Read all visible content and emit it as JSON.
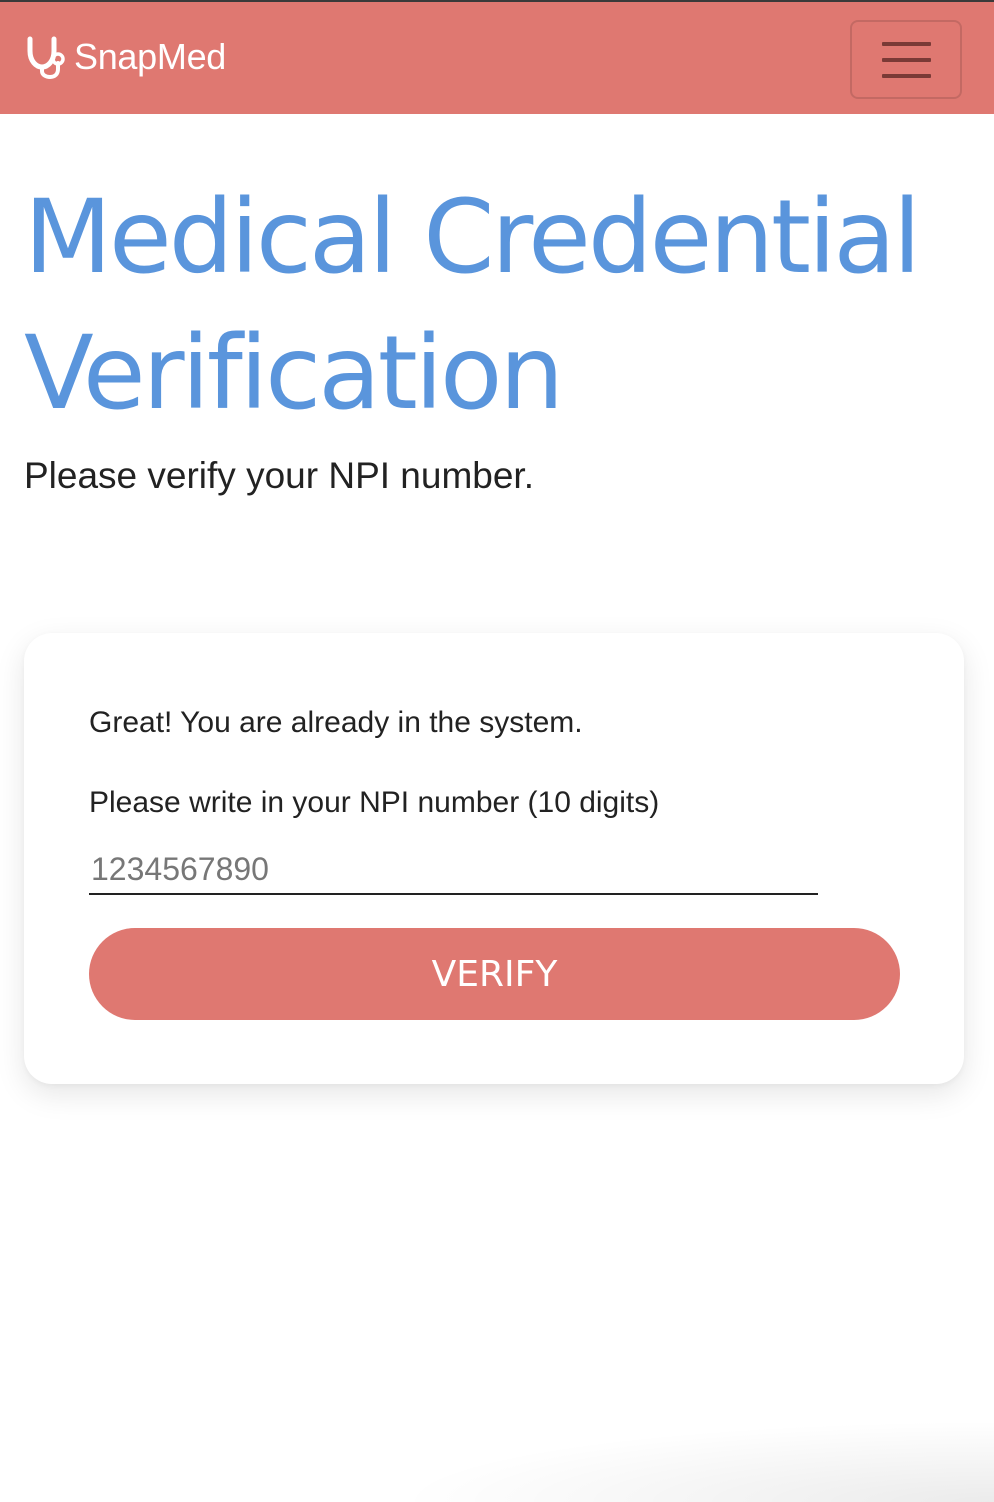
{
  "navbar": {
    "brand_name": "SnapMed",
    "brand_icon": "stethoscope-icon",
    "menu_icon": "hamburger-menu-icon",
    "color": "#df7871"
  },
  "header": {
    "title_line1": "Medical Credential",
    "title_line2": "Verification",
    "subtitle": "Please verify your NPI number.",
    "title_color": "#5a95dc"
  },
  "card": {
    "message": "Great! You are already in the system.",
    "npi_label": "Please write in your NPI number (10 digits)",
    "npi_value": "",
    "npi_placeholder": "1234567890",
    "verify_label": "VERIFY"
  }
}
